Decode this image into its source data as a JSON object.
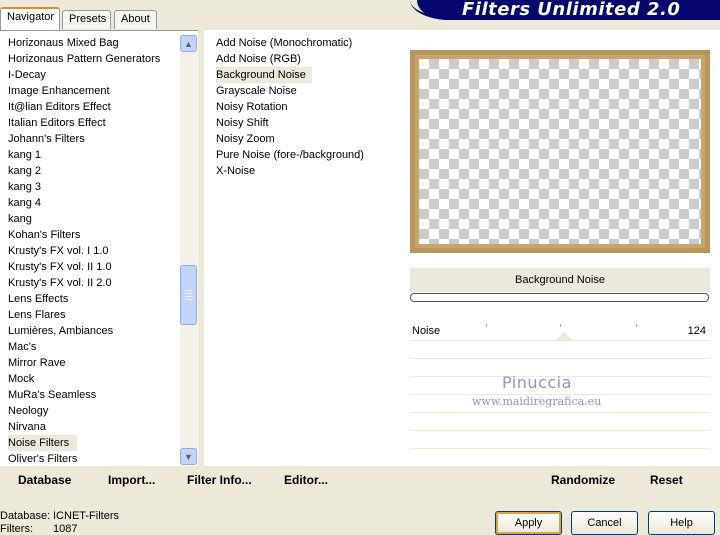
{
  "tabs": [
    "Navigator",
    "Presets",
    "About"
  ],
  "banner_title": "Filters Unlimited 2.0",
  "categories": [
    "Horizonaus Mixed Bag",
    "Horizonaus Pattern Generators",
    "I-Decay",
    "Image Enhancement",
    "It@lian Editors Effect",
    "Italian Editors Effect",
    "Johann's Filters",
    "kang 1",
    "kang 2",
    "kang 3",
    "kang 4",
    "kang",
    "Kohan's Filters",
    "Krusty's FX vol. I 1.0",
    "Krusty's FX vol. II 1.0",
    "Krusty's FX vol. II 2.0",
    "Lens Effects",
    "Lens Flares",
    "Lumières, Ambiances",
    "Mac's",
    "Mirror Rave",
    "Mock",
    "MuRa's Seamless",
    "Neology",
    "Nirvana",
    "Noise Filters",
    "Oliver's Filters"
  ],
  "selected_category": "Noise Filters",
  "filters": [
    "Add Noise (Monochromatic)",
    "Add Noise (RGB)",
    "Background Noise",
    "Grayscale Noise",
    "Noisy Rotation",
    "Noisy Shift",
    "Noisy Zoom",
    "Pure Noise (fore-/background)",
    "X-Noise"
  ],
  "selected_filter": "Background Noise",
  "filter_title": "Background Noise",
  "parameter": {
    "label": "Noise",
    "value": "124"
  },
  "watermark": {
    "name": "Pinuccia",
    "url": "www.maidiregrafica.eu"
  },
  "toolbar": {
    "database": "Database",
    "import": "Import...",
    "filter_info": "Filter Info...",
    "editor": "Editor...",
    "randomize": "Randomize",
    "reset": "Reset"
  },
  "status": {
    "database_label": "Database:",
    "database_value": "ICNET-Filters",
    "filters_label": "Filters:",
    "filters_value": "1087"
  },
  "buttons": {
    "apply": "Apply",
    "cancel": "Cancel",
    "help": "Help"
  },
  "colors": {
    "banner": "#06066e",
    "frame": "#b8955a",
    "watermark": "#8a96c8"
  }
}
